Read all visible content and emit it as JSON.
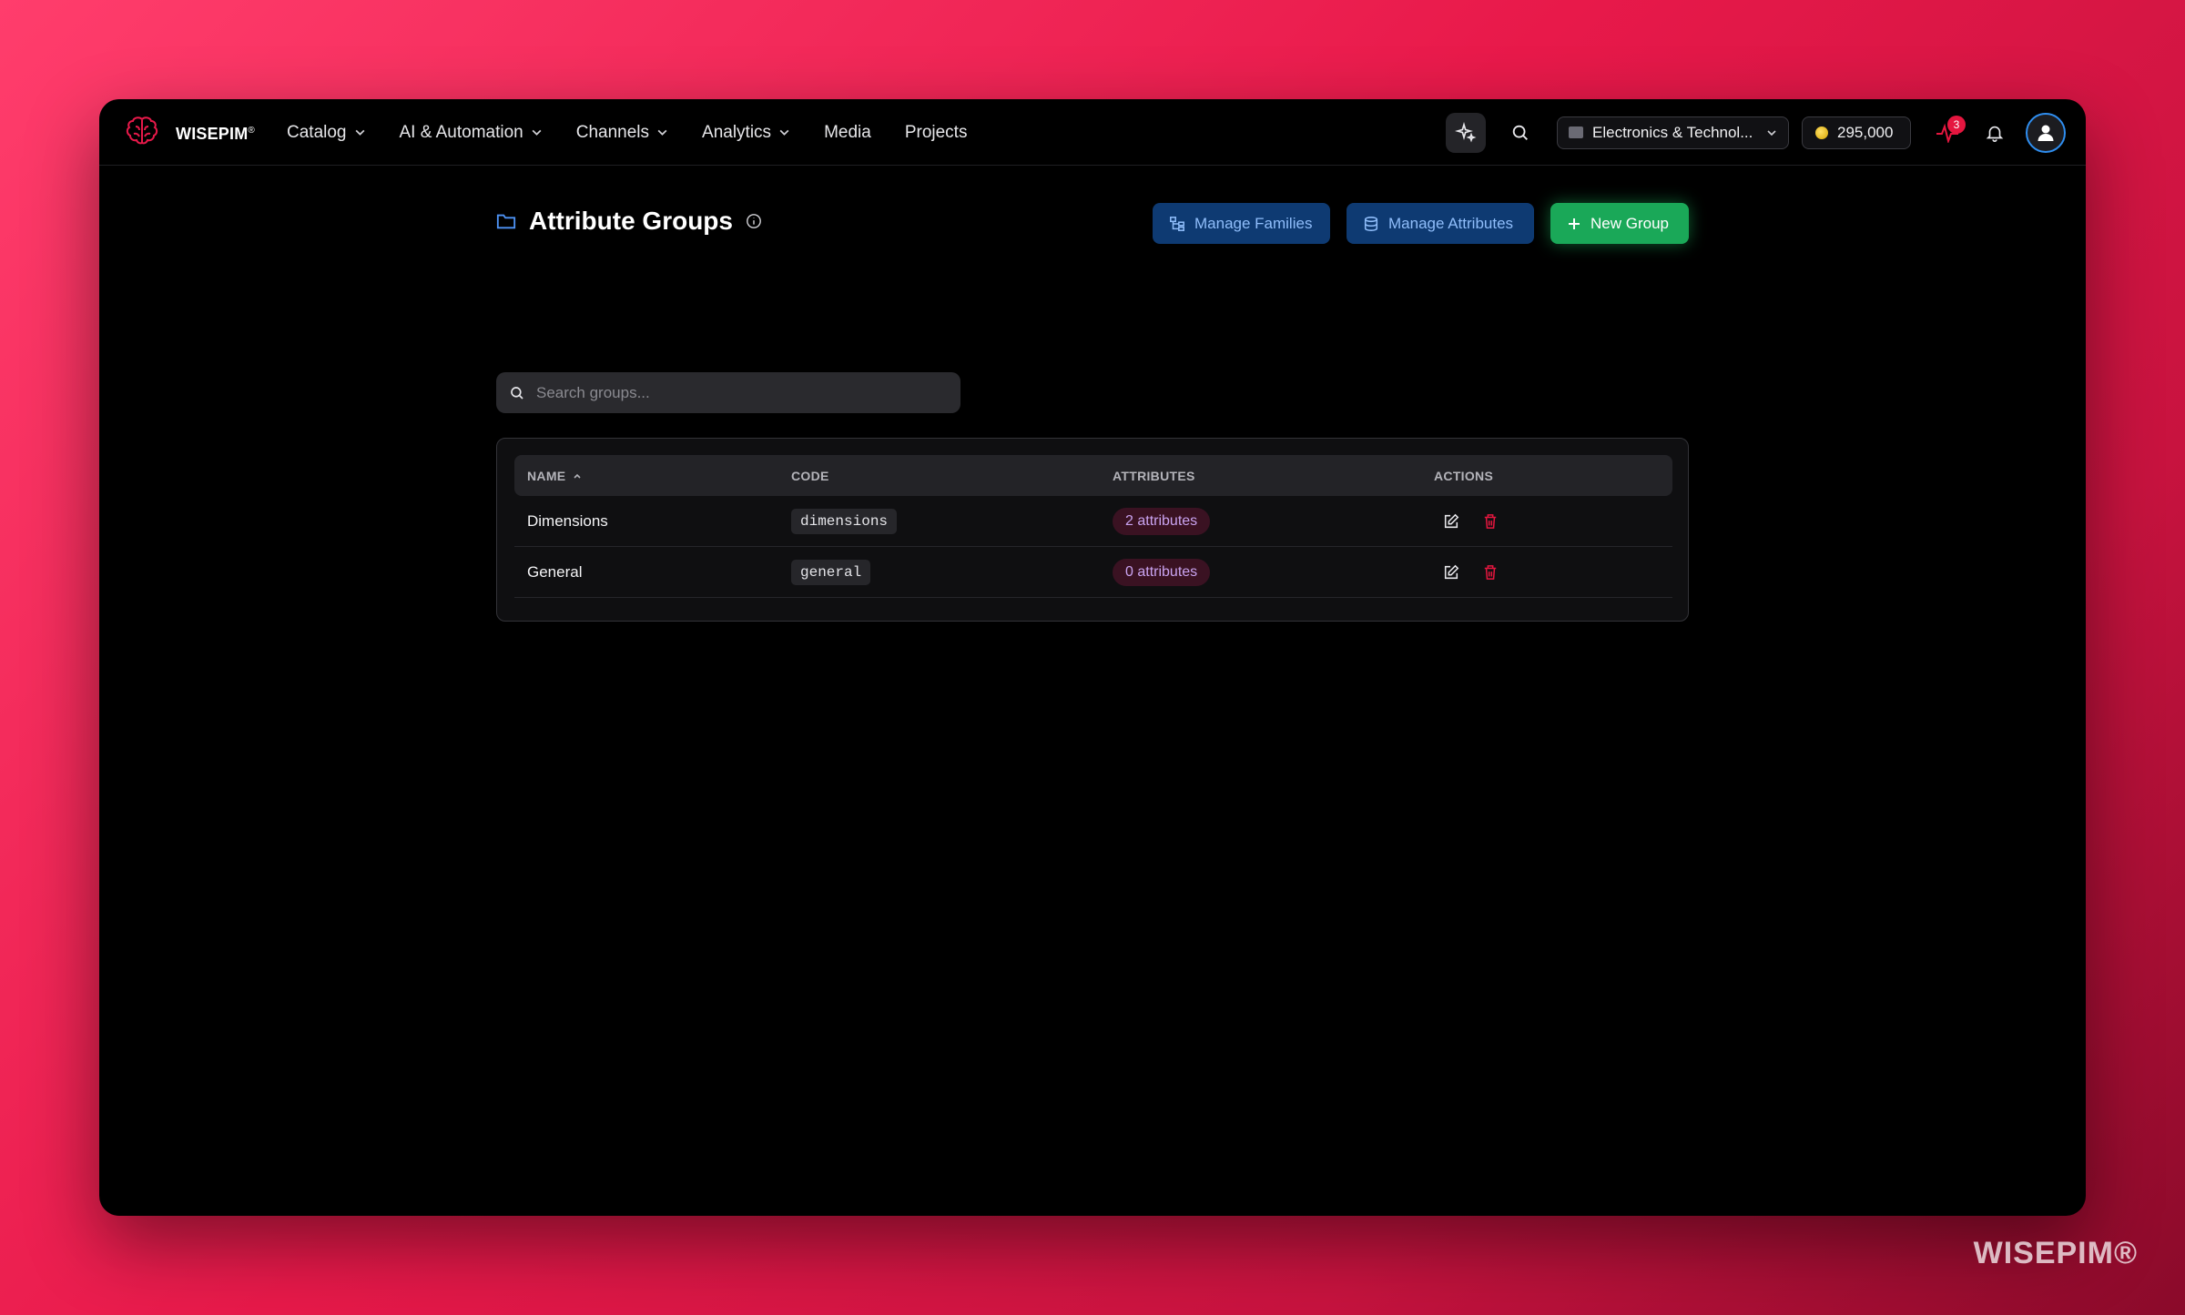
{
  "brand": {
    "name": "WISEPIM",
    "mark": "®"
  },
  "nav": [
    {
      "label": "Catalog",
      "dropdown": true
    },
    {
      "label": "AI & Automation",
      "dropdown": true
    },
    {
      "label": "Channels",
      "dropdown": true
    },
    {
      "label": "Analytics",
      "dropdown": true
    },
    {
      "label": "Media",
      "dropdown": false
    },
    {
      "label": "Projects",
      "dropdown": false
    }
  ],
  "topbar": {
    "project": "Electronics & Technol...",
    "credits": "295,000",
    "activity_badge": "3"
  },
  "page": {
    "title": "Attribute Groups",
    "buttons": {
      "manage_families": "Manage Families",
      "manage_attributes": "Manage Attributes",
      "new_group": "New Group"
    },
    "search_placeholder": "Search groups..."
  },
  "table": {
    "headers": {
      "name": "NAME",
      "code": "CODE",
      "attributes": "ATTRIBUTES",
      "actions": "ACTIONS"
    },
    "rows": [
      {
        "name": "Dimensions",
        "code": "dimensions",
        "attributes": "2 attributes"
      },
      {
        "name": "General",
        "code": "general",
        "attributes": "0 attributes"
      }
    ]
  },
  "watermark": "WISEPIM®",
  "colors": {
    "accent_blue": "#2f8ef0",
    "primary_green": "#1aa858",
    "danger_red": "#e5163f",
    "background_pink": "#e8194a"
  }
}
